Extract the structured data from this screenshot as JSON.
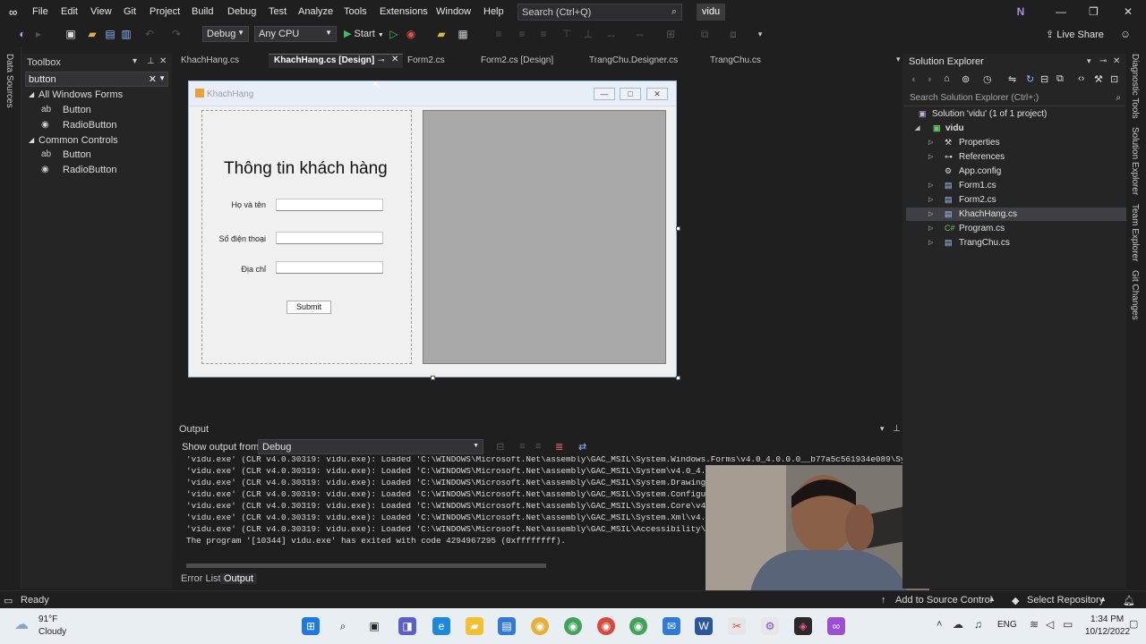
{
  "menu": [
    "File",
    "Edit",
    "View",
    "Git",
    "Project",
    "Build",
    "Debug",
    "Test",
    "Analyze",
    "Tools",
    "Extensions",
    "Window",
    "Help"
  ],
  "search": {
    "placeholder": "Search (Ctrl+Q)"
  },
  "solution_badge": "vidu",
  "user_initial": "N",
  "toolbar": {
    "config": "Debug",
    "platform": "Any CPU",
    "start": "Start",
    "live_share": "Live Share"
  },
  "left_rail": {
    "label": "Data Sources"
  },
  "toolbox": {
    "title": "Toolbox",
    "search_value": "button",
    "groups": [
      {
        "label": "All Windows Forms",
        "items": [
          "Button",
          "RadioButton"
        ]
      },
      {
        "label": "Common Controls",
        "items": [
          "Button",
          "RadioButton"
        ]
      }
    ]
  },
  "doc_tabs": [
    "KhachHang.cs",
    "KhachHang.cs [Design]",
    "Form2.cs",
    "Form2.cs [Design]",
    "TrangChu.Designer.cs",
    "TrangChu.cs"
  ],
  "form": {
    "caption": "KhachHang",
    "heading": "Thông tin khách hàng",
    "fields": [
      "Họ và tên",
      "Số điện thoại",
      "Địa chỉ"
    ],
    "submit": "Submit"
  },
  "output": {
    "title": "Output",
    "show_from_label": "Show output from:",
    "show_from_value": "Debug",
    "lines": [
      "'vidu.exe' (CLR v4.0.30319: vidu.exe): Loaded 'C:\\WINDOWS\\Microsoft.Net\\assembly\\GAC_MSIL\\System.Windows.Forms\\v4.0_4.0.0.0__b77a5c561934e089\\System.W",
      "'vidu.exe' (CLR v4.0.30319: vidu.exe): Loaded 'C:\\WINDOWS\\Microsoft.Net\\assembly\\GAC_MSIL\\System\\v4.0_4.0.0.0",
      "'vidu.exe' (CLR v4.0.30319: vidu.exe): Loaded 'C:\\WINDOWS\\Microsoft.Net\\assembly\\GAC_MSIL\\System.Drawing\\v4.0",
      "'vidu.exe' (CLR v4.0.30319: vidu.exe): Loaded 'C:\\WINDOWS\\Microsoft.Net\\assembly\\GAC_MSIL\\System.Configuratio",
      "'vidu.exe' (CLR v4.0.30319: vidu.exe): Loaded 'C:\\WINDOWS\\Microsoft.Net\\assembly\\GAC_MSIL\\System.Core\\v4.0_4.",
      "'vidu.exe' (CLR v4.0.30319: vidu.exe): Loaded 'C:\\WINDOWS\\Microsoft.Net\\assembly\\GAC_MSIL\\System.Xml\\v4.0_4.0",
      "'vidu.exe' (CLR v4.0.30319: vidu.exe): Loaded 'C:\\WINDOWS\\Microsoft.Net\\assembly\\GAC_MSIL\\Accessibility\\v4.0",
      "The program '[10344] vidu.exe' has exited with code 4294967295 (0xffffffff)."
    ],
    "tabs": [
      "Error List",
      "Output"
    ]
  },
  "solution_explorer": {
    "title": "Solution Explorer",
    "search_placeholder": "Search Solution Explorer (Ctrl+;)",
    "solution": "Solution 'vidu' (1 of 1 project)",
    "project": "vidu",
    "items": [
      "Properties",
      "References",
      "App.config",
      "Form1.cs",
      "Form2.cs",
      "KhachHang.cs",
      "Program.cs",
      "TrangChu.cs"
    ],
    "selected": "KhachHang.cs"
  },
  "right_rail": [
    "Diagnostic Tools",
    "Solution Explorer",
    "Team Explorer",
    "Git Changes"
  ],
  "status": {
    "left": "Ready",
    "source_control": "Add to Source Control",
    "repository": "Select Repository"
  },
  "taskbar": {
    "temp": "91°F",
    "weather": "Cloudy",
    "lang": "ENG",
    "time": "1:34 PM",
    "date": "10/12/2022"
  },
  "colors": {
    "accent": "#007acc",
    "form_bg": "#f0f0f0",
    "panel_gray": "#a9a9a9",
    "vs_logo": "#9b4fd6"
  }
}
